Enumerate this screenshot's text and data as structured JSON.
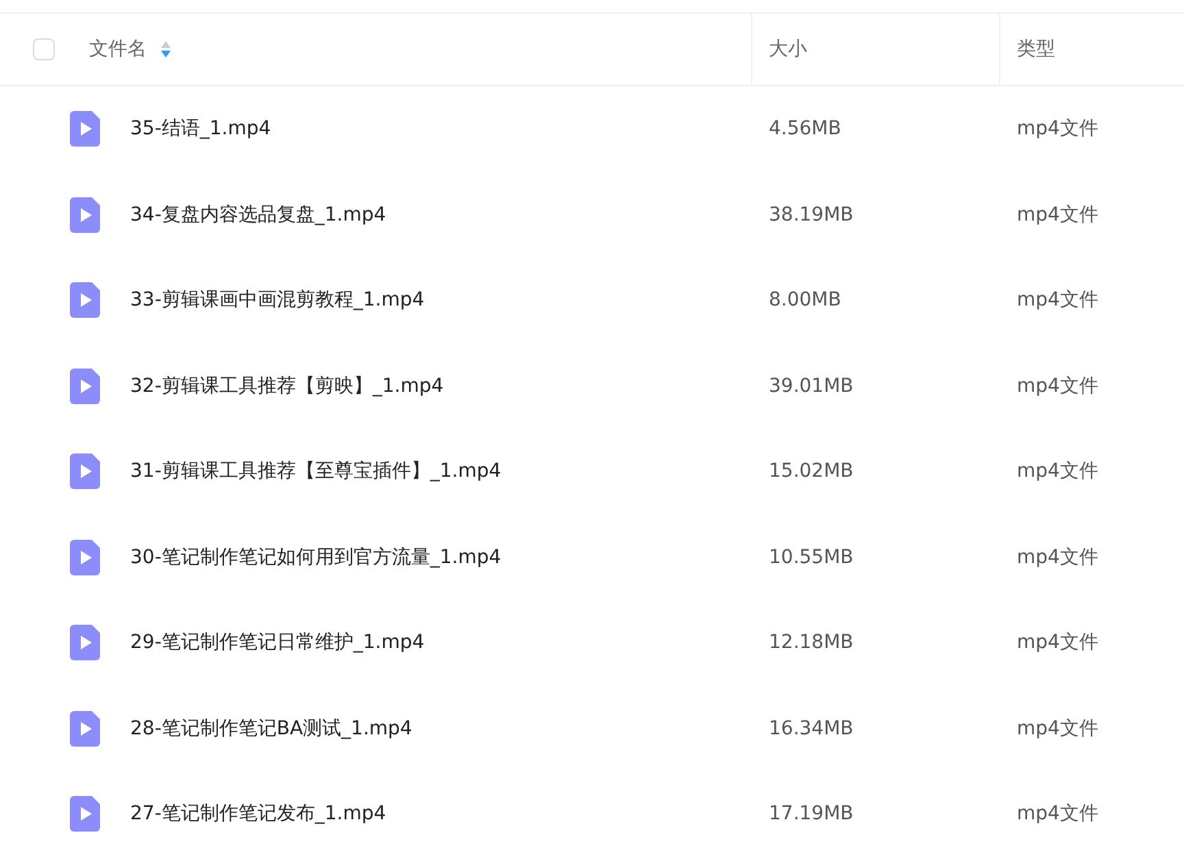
{
  "header": {
    "checked": false,
    "columns": [
      {
        "label": "文件名",
        "sorted_descending": true
      },
      {
        "label": "大小"
      },
      {
        "label": "类型"
      }
    ]
  },
  "rows": [
    {
      "name": "35-结语_1.mp4",
      "size": "4.56MB",
      "type": "mp4文件"
    },
    {
      "name": "34-复盘内容选品复盘_1.mp4",
      "size": "38.19MB",
      "type": "mp4文件"
    },
    {
      "name": "33-剪辑课画中画混剪教程_1.mp4",
      "size": "8.00MB",
      "type": "mp4文件"
    },
    {
      "name": "32-剪辑课工具推荐【剪映】_1.mp4",
      "size": "39.01MB",
      "type": "mp4文件"
    },
    {
      "name": "31-剪辑课工具推荐【至尊宝插件】_1.mp4",
      "size": "15.02MB",
      "type": "mp4文件"
    },
    {
      "name": "30-笔记制作笔记如何用到官方流量_1.mp4",
      "size": "10.55MB",
      "type": "mp4文件"
    },
    {
      "name": "29-笔记制作笔记日常维护_1.mp4",
      "size": "12.18MB",
      "type": "mp4文件"
    },
    {
      "name": "28-笔记制作笔记BA测试_1.mp4",
      "size": "16.34MB",
      "type": "mp4文件"
    },
    {
      "name": "27-笔记制作笔记发布_1.mp4",
      "size": "17.19MB",
      "type": "mp4文件"
    }
  ]
}
